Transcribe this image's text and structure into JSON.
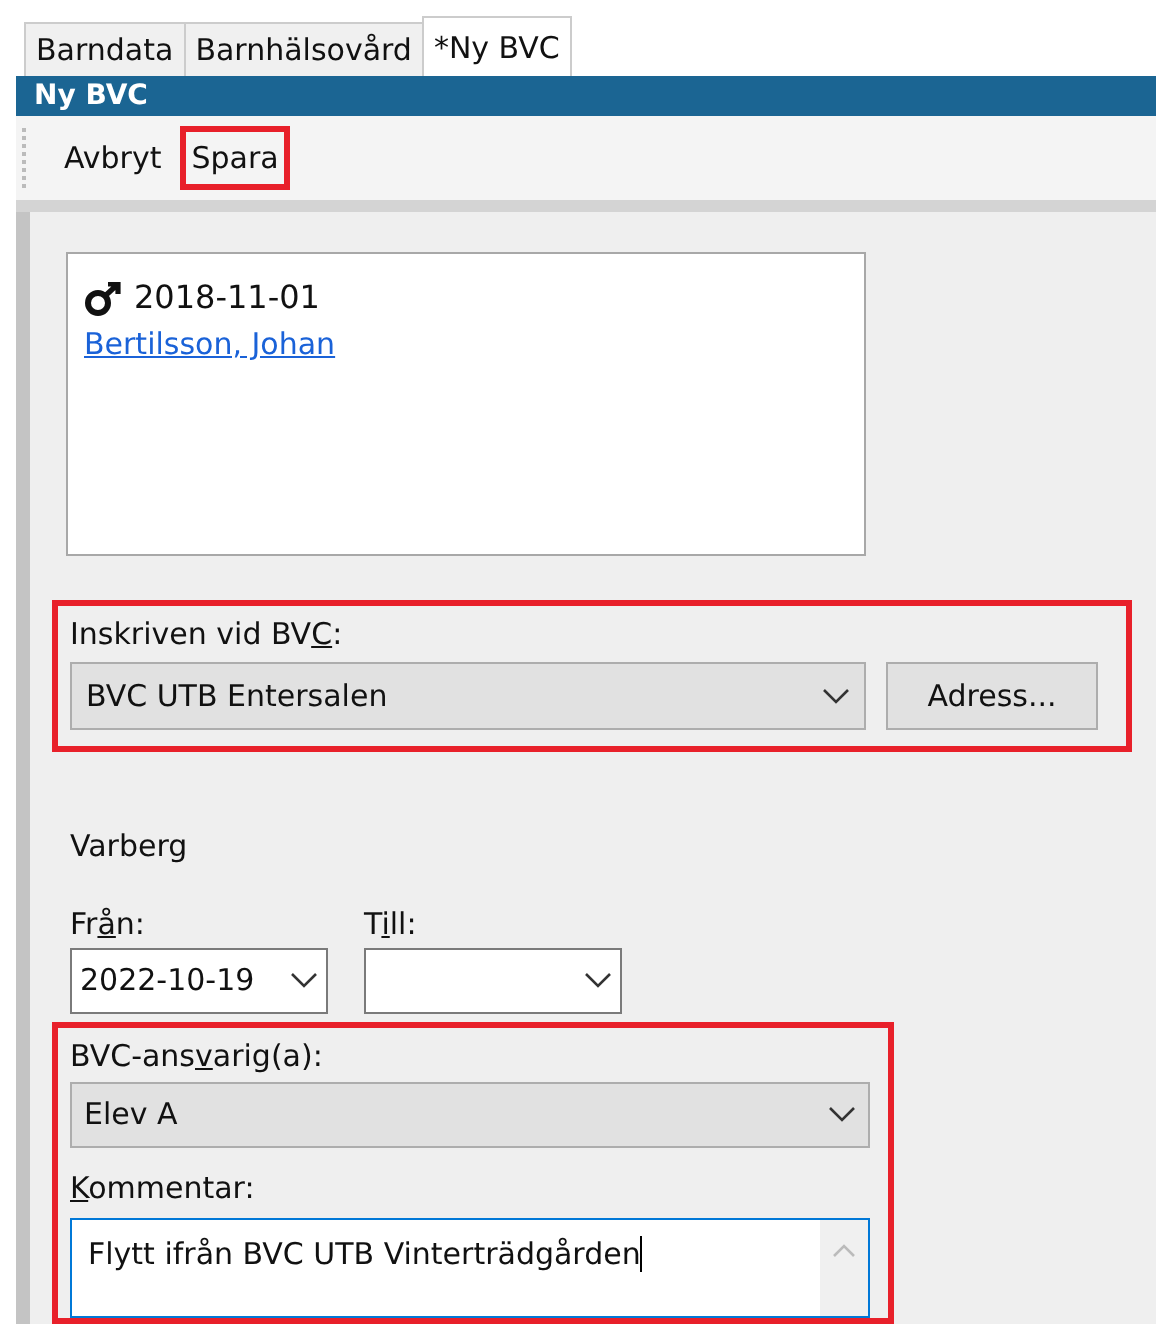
{
  "tabs": [
    {
      "label": "Barndata",
      "selected": false
    },
    {
      "label": "Barnhälsovård",
      "selected": false
    },
    {
      "label": "*Ny BVC",
      "selected": true
    }
  ],
  "title": "Ny BVC",
  "toolbar": [
    {
      "label": "Avbryt",
      "highlighted": false
    },
    {
      "label": "Spara",
      "highlighted": true
    }
  ],
  "person": {
    "birth_date": "2018-11-01",
    "name": "Bertilsson, Johan"
  },
  "clinic": {
    "highlighted": true,
    "label": {
      "before": "Inskriven vid BV",
      "key": "C",
      "after": ":"
    },
    "value": "BVC UTB Entersalen",
    "button": "Adress..."
  },
  "town": "Varberg",
  "dates": [
    {
      "label": {
        "before": "Fr",
        "key": "å",
        "after": "n:"
      },
      "value": "2022-10-19"
    },
    {
      "label": {
        "before": "T",
        "key": "i",
        "after": "ll:"
      }
    }
  ],
  "responsible": {
    "highlighted": true,
    "label": {
      "before": "BVC-ans",
      "key": "v",
      "after": "arig(a):"
    },
    "value": "Elev A",
    "comment_label": {
      "key": "K",
      "after": "ommentar:"
    },
    "comment": "Flytt ifrån BVC UTB Vinterträdgården"
  }
}
